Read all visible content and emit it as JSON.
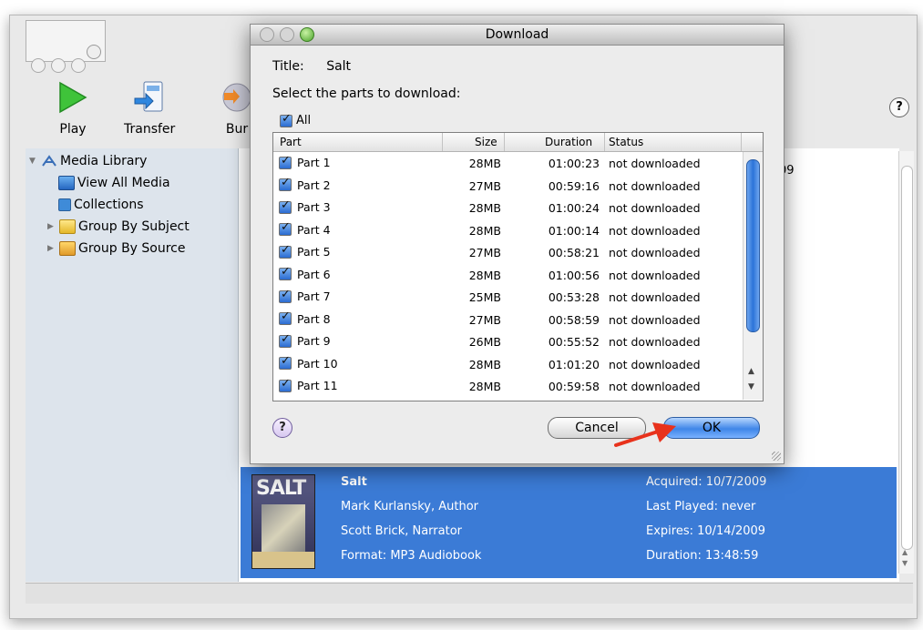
{
  "toolbar": {
    "play_label": "Play",
    "transfer_label": "Transfer",
    "burn_label": "Bur",
    "help_symbol": "?"
  },
  "sidebar": {
    "items": [
      {
        "label": "Media Library",
        "icon": "media-library-icon"
      },
      {
        "label": "View All Media",
        "icon": "view-all-media-icon"
      },
      {
        "label": "Collections",
        "icon": "collections-icon"
      },
      {
        "label": "Group By Subject",
        "icon": "folder-icon"
      },
      {
        "label": "Group By Source",
        "icon": "source-icon"
      }
    ]
  },
  "content": {
    "partial_text": "09"
  },
  "selected_item": {
    "cover_text": "SALT",
    "title": "Salt",
    "author": "Mark Kurlansky, Author",
    "narrator": "Scott Brick, Narrator",
    "format": "Format: MP3 Audiobook",
    "acquired": "Acquired: 10/7/2009",
    "last_played": "Last Played: never",
    "expires": "Expires: 10/14/2009",
    "duration": "Duration: 13:48:59"
  },
  "dialog": {
    "window_title": "Download",
    "title_label": "Title:",
    "title_value": "Salt",
    "prompt": "Select the parts to download:",
    "all_label": "All",
    "columns": [
      "Part",
      "Size",
      "Duration",
      "Status"
    ],
    "rows": [
      {
        "part": "Part 1",
        "size": "28MB",
        "duration": "01:00:23",
        "status": "not downloaded"
      },
      {
        "part": "Part 2",
        "size": "27MB",
        "duration": "00:59:16",
        "status": "not downloaded"
      },
      {
        "part": "Part 3",
        "size": "28MB",
        "duration": "01:00:24",
        "status": "not downloaded"
      },
      {
        "part": "Part 4",
        "size": "28MB",
        "duration": "01:00:14",
        "status": "not downloaded"
      },
      {
        "part": "Part 5",
        "size": "27MB",
        "duration": "00:58:21",
        "status": "not downloaded"
      },
      {
        "part": "Part 6",
        "size": "28MB",
        "duration": "01:00:56",
        "status": "not downloaded"
      },
      {
        "part": "Part 7",
        "size": "25MB",
        "duration": "00:53:28",
        "status": "not downloaded"
      },
      {
        "part": "Part 8",
        "size": "27MB",
        "duration": "00:58:59",
        "status": "not downloaded"
      },
      {
        "part": "Part 9",
        "size": "26MB",
        "duration": "00:55:52",
        "status": "not downloaded"
      },
      {
        "part": "Part 10",
        "size": "28MB",
        "duration": "01:01:20",
        "status": "not downloaded"
      },
      {
        "part": "Part 11",
        "size": "28MB",
        "duration": "00:59:58",
        "status": "not downloaded"
      }
    ],
    "help_symbol": "?",
    "cancel_label": "Cancel",
    "ok_label": "OK"
  },
  "colors": {
    "selection": "#3b7bd6",
    "accent_button": "#3f86e8",
    "annotation_arrow": "#e8321c"
  }
}
